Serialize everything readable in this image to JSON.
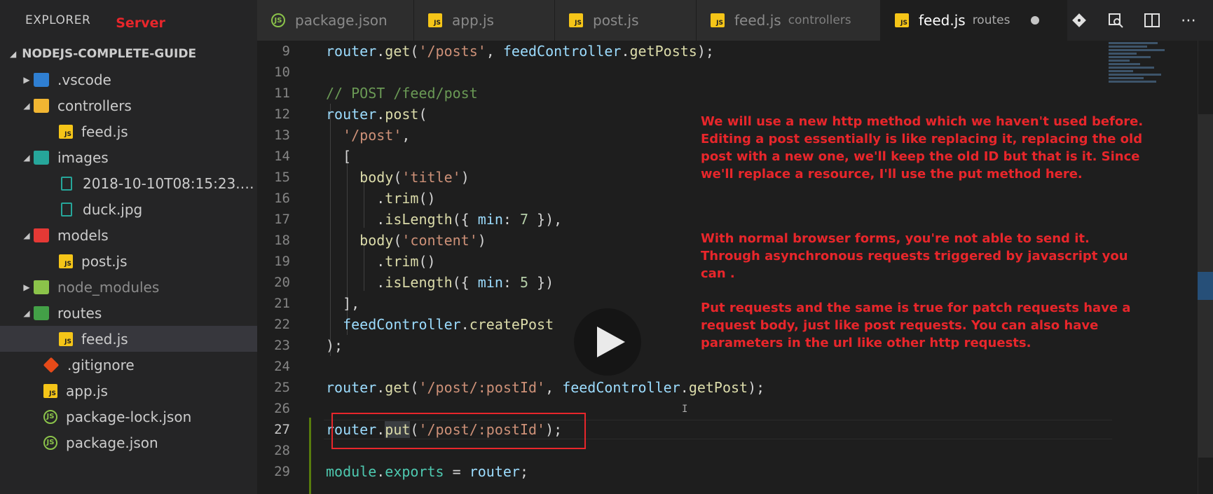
{
  "sidebar": {
    "title": "EXPLORER",
    "server_note": "Server",
    "project": "NODEJS-COMPLETE-GUIDE",
    "items": [
      {
        "label": ".vscode"
      },
      {
        "label": "controllers"
      },
      {
        "label": "feed.js"
      },
      {
        "label": "images"
      },
      {
        "label": "2018-10-10T08:15:23.5..."
      },
      {
        "label": "duck.jpg"
      },
      {
        "label": "models"
      },
      {
        "label": "post.js"
      },
      {
        "label": "node_modules"
      },
      {
        "label": "routes"
      },
      {
        "label": "feed.js"
      },
      {
        "label": ".gitignore"
      },
      {
        "label": "app.js"
      },
      {
        "label": "package-lock.json"
      },
      {
        "label": "package.json"
      }
    ]
  },
  "tabs": [
    {
      "label": "package.json",
      "icon": "json-icon"
    },
    {
      "label": "app.js",
      "icon": "js-icon"
    },
    {
      "label": "post.js",
      "icon": "js-icon"
    },
    {
      "label": "feed.js",
      "desc": "controllers",
      "icon": "js-icon"
    },
    {
      "label": "feed.js",
      "desc": "routes",
      "icon": "js-icon",
      "active": true,
      "modified": true
    }
  ],
  "editor": {
    "line_numbers": [
      "9",
      "10",
      "11",
      "12",
      "13",
      "14",
      "15",
      "16",
      "17",
      "18",
      "19",
      "20",
      "21",
      "22",
      "23",
      "24",
      "25",
      "26",
      "27",
      "28",
      "29"
    ],
    "annotation": {
      "p1": "We will use a new http method which we haven't used before. Editing a post essentially is like replacing it, replacing the old post with a new one, we'll keep the old ID but that is it. Since we'll replace a resource, I'll use the put method here.",
      "p2": "With normal browser forms, you're not able to send it. Through asynchronous requests triggered by javascript you can .",
      "p3": "Put requests and the same is true for patch requests have a request body, just like post requests. You can also have parameters in the url like other http requests."
    }
  },
  "colors": {
    "accent": "#e8262b",
    "background": "#1e1e1e",
    "sidebar": "#252526"
  }
}
